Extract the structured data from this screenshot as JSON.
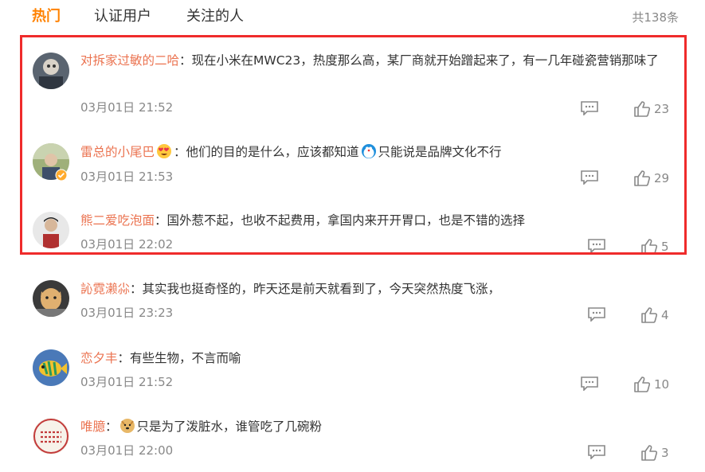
{
  "tabs": [
    {
      "label": "热门"
    },
    {
      "label": "认证用户"
    },
    {
      "label": "关注的人"
    }
  ],
  "total_count": "共138条",
  "accent_color": "#ff8200",
  "username_color": "#eb7350",
  "highlight_color": "#ef2b2b",
  "comments": [
    {
      "user": "对拆家过敏的二哈",
      "text": "现在小米在MWC23，热度那么高，某厂商就开始蹭起来了，有一几年碰瓷营销那味了",
      "time": "03月01日 21:52",
      "likes": "23"
    },
    {
      "user": "雷总的小尾巴",
      "text_a": "他们的目的是什么，应该都知道",
      "text_b": "只能说是品牌文化不行",
      "time": "03月01日 21:53",
      "likes": "29",
      "verified": true
    },
    {
      "user": "熊二爱吃泡面",
      "text": "国外惹不起，也收不起费用，拿国内来开开胃口，也是不错的选择",
      "time": "03月01日 22:02",
      "likes": "5"
    },
    {
      "user": "訫霓濑尛",
      "text": "其实我也挺奇怪的，昨天还是前天就看到了，今天突然热度飞涨，",
      "time": "03月01日 23:23",
      "likes": "4"
    },
    {
      "user": "恋夕丰",
      "text": "有些生物，不言而喻",
      "time": "03月01日 21:52",
      "likes": "10"
    },
    {
      "user": "唯臆",
      "text": "只是为了泼脏水，谁管吃了几碗粉",
      "time": "03月01日 22:00",
      "likes": "3"
    }
  ],
  "icons": {
    "reply": "comment-icon",
    "like": "thumbs-up-icon",
    "verified": "verified-badge-icon"
  }
}
